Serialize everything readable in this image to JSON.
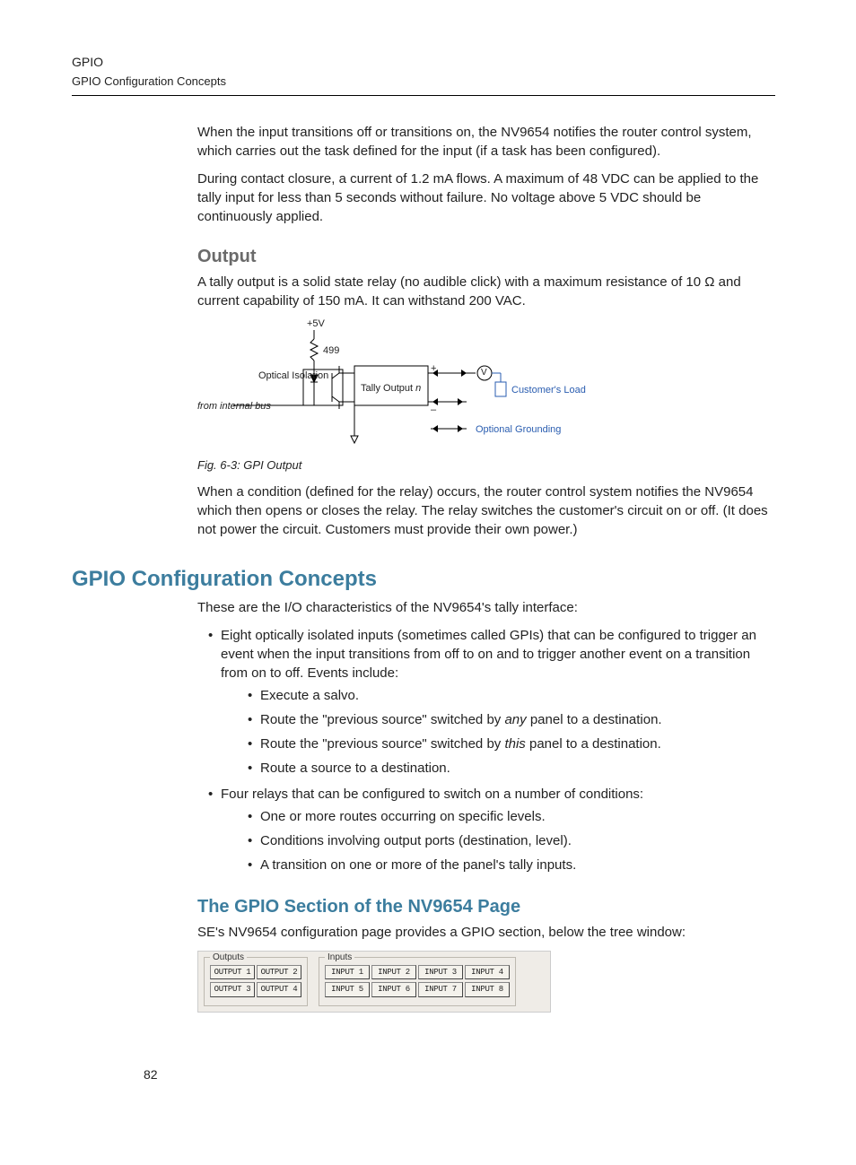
{
  "header": {
    "running_head": "GPIO",
    "running_sub": "GPIO Configuration Concepts"
  },
  "intro": {
    "p1": "When the input transitions off or transitions on, the NV9654 notifies the router control system, which carries out the task defined for the input (if a task has been configured).",
    "p2": "During contact closure, a current of 1.2 mA flows. A maximum of 48 VDC can be applied to the tally input for less than 5 seconds without failure. No voltage above 5 VDC should be continuously applied."
  },
  "output": {
    "heading": "Output",
    "p1": "A tally output is a solid state relay (no audible click) with a maximum resistance of 10 Ω and current capability of 150 mA. It can withstand 200 VAC.",
    "fig_caption": "Fig. 6-3: GPI Output",
    "p2": "When a condition (defined for the relay) occurs, the router control system notifies the NV9654 which then opens or closes the relay. The relay switches the customer's circuit on or off. (It does not power the circuit. Customers must provide their own power.)"
  },
  "circuit": {
    "plus5v": "+5V",
    "r499": "499",
    "optical_isolation": "Optical Isolation",
    "from_internal_bus": "from internal bus",
    "tally_output_pre": "Tally Output ",
    "tally_output_n": "n",
    "v": "V",
    "plus": "+",
    "minus": "–",
    "customers_load": "Customer's Load",
    "optional_grounding": "Optional Grounding"
  },
  "concepts": {
    "heading": "GPIO Configuration Concepts",
    "intro": "These are the I/O characteristics of the NV9654's tally interface:",
    "b1_pre": "Eight optically isolated inputs (sometimes called GPIs) that can be configured to trigger an event when the input transitions from off to on and to trigger another event on a transition from on to off. Events include:",
    "b1_sub1": "Execute a salvo.",
    "b1_sub2_pre": "Route the \"previous source\" switched by ",
    "b1_sub2_em": "any",
    "b1_sub2_post": " panel to a destination.",
    "b1_sub3_pre": "Route the \"previous source\" switched by ",
    "b1_sub3_em": "this",
    "b1_sub3_post": " panel to a destination.",
    "b1_sub4": "Route a source to a destination.",
    "b2": "Four relays that can be configured to switch on a number of conditions:",
    "b2_sub1": "One or more routes occurring on specific levels.",
    "b2_sub2": "Conditions involving output ports (destination, level).",
    "b2_sub3": "A transition on one or more of the panel's tally inputs."
  },
  "gpio_section": {
    "heading": "The GPIO Section of the NV9654 Page",
    "p1": "SE's NV9654 configuration page provides a GPIO section, below the tree window:",
    "outputs_legend": "Outputs",
    "inputs_legend": "Inputs",
    "outputs": [
      "OUTPUT 1",
      "OUTPUT 2",
      "OUTPUT 3",
      "OUTPUT 4"
    ],
    "inputs": [
      "INPUT 1",
      "INPUT 2",
      "INPUT 3",
      "INPUT 4",
      "INPUT 5",
      "INPUT 6",
      "INPUT 7",
      "INPUT 8"
    ]
  },
  "page_number": "82"
}
